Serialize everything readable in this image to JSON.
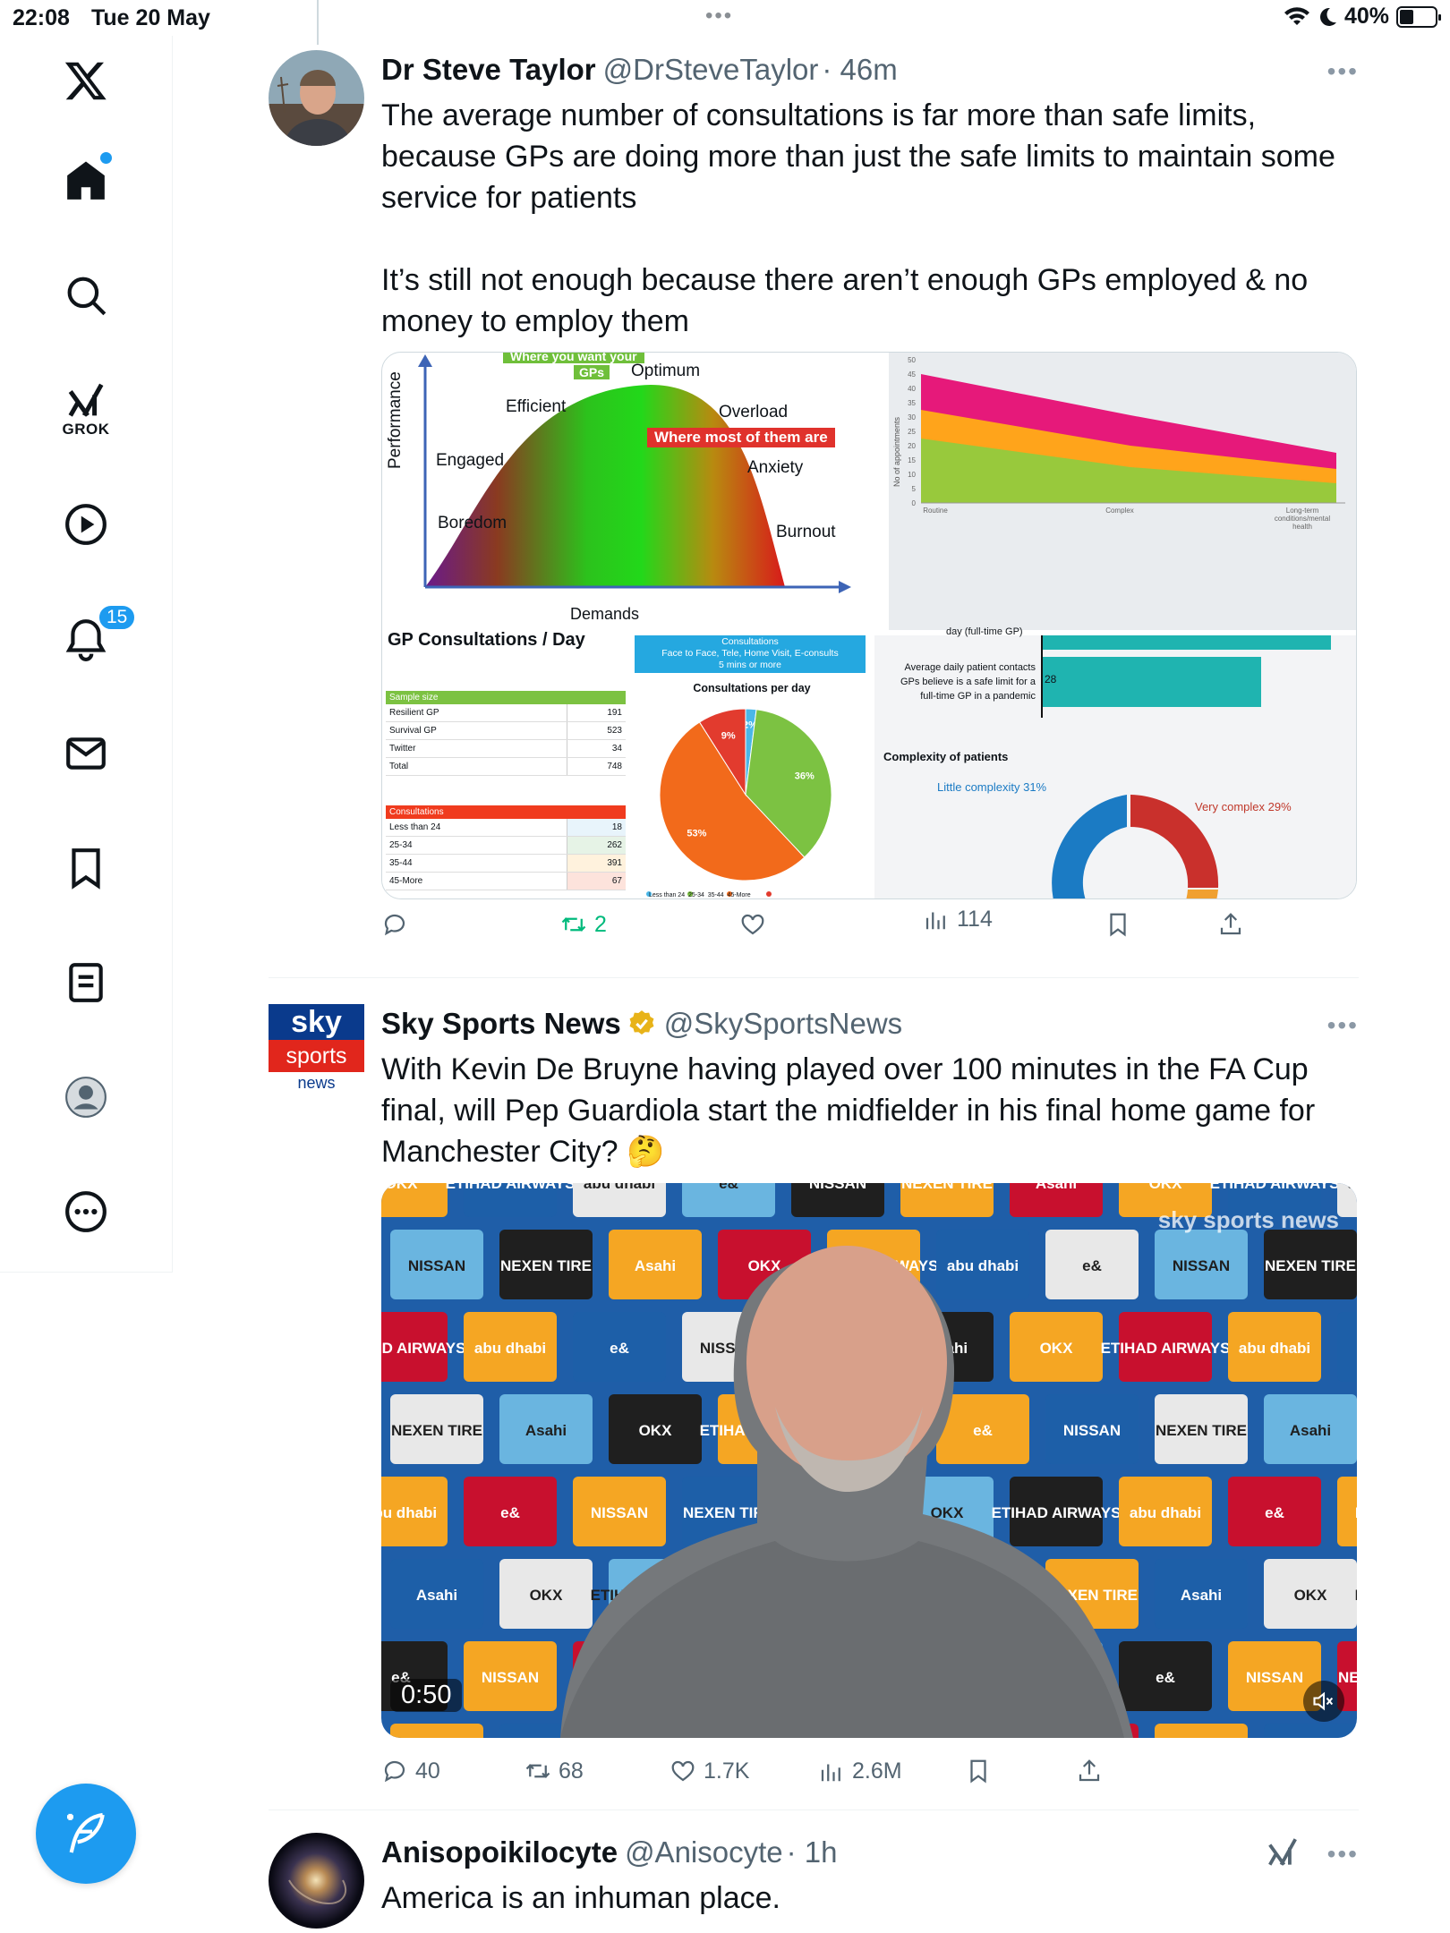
{
  "status_bar": {
    "time": "22:08",
    "date": "Tue 20 May",
    "battery": "40%",
    "battery_level": 0.4
  },
  "sidebar": {
    "grok_label": "GROK",
    "notifications_count": "15"
  },
  "tweets": [
    {
      "name": "Dr Steve Taylor",
      "handle": "@DrSteveTaylor",
      "time": "· 46m",
      "text": "The average number of consultations is far more than safe limits, because GPs are doing more than just the safe limits to maintain some service for patients\n\nIt’s still not enough because there aren’t enough GPs employed & no money to employ them",
      "stats": {
        "replies": "",
        "reposts": "2",
        "likes": "",
        "views": "114"
      },
      "media": {
        "curve": {
          "ylabel": "Performance",
          "xlabel": "Demands",
          "banner_top": "Where you want your",
          "banner_gps": "GPs",
          "optimum": "Optimum",
          "efficient": "Efficient",
          "engaged": "Engaged",
          "boredom": "Boredom",
          "overload": "Overload",
          "where_most": "Where most of them are",
          "anxiety": "Anxiety",
          "burnout": "Burnout"
        },
        "area_chart": {
          "ylabel": "No of appointments",
          "yticks": [
            "50",
            "45",
            "40",
            "35",
            "30",
            "25",
            "20",
            "15",
            "10",
            "5",
            "0"
          ],
          "categories": [
            "Routine",
            "Complex",
            "Long-term conditions/mental health"
          ]
        },
        "table": {
          "title": "GP Consultations / Day",
          "sample_header": "Sample size",
          "sample_rows": [
            {
              "label": "Resilient GP",
              "value": "191"
            },
            {
              "label": "Survival GP",
              "value": "523"
            },
            {
              "label": "Twitter",
              "value": "34"
            },
            {
              "label": "Total",
              "value": "748"
            }
          ],
          "cons_header": "Consultations",
          "cons_rows": [
            {
              "label": "Less than 24",
              "value": "18"
            },
            {
              "label": "25-34",
              "value": "262"
            },
            {
              "label": "35-44",
              "value": "391"
            },
            {
              "label": "45-More",
              "value": "67"
            }
          ]
        },
        "pie": {
          "banner_top": "Consultations",
          "banner": "Face to Face, Tele, Home Visit, E-consults",
          "banner2": "5 mins or more",
          "title": "Consultations per day",
          "slices": [
            {
              "label": "2%",
              "value": 2,
              "color": "#4ab7e8"
            },
            {
              "label": "36%",
              "value": 36,
              "color": "#7cc242"
            },
            {
              "label": "53%",
              "value": 53,
              "color": "#f26a1b"
            },
            {
              "label": "9%",
              "value": 9,
              "color": "#e23b2e"
            }
          ],
          "legend": "Less than 24  25-34  35-44  45-More"
        },
        "bars": {
          "top_label": "day (full-time GP)",
          "label1": "Average daily patient contacts",
          "label2": "GPs believe is a safe limit for a",
          "label3": "full-time GP in a pandemic",
          "value": "28",
          "complexity_title": "Complexity of patients",
          "little": "Little complexity 31%",
          "very": "Very complex 29%"
        }
      }
    },
    {
      "name": "Sky Sports News",
      "handle": "@SkySportsNews",
      "time": "",
      "text": "With Kevin De Bruyne having played over 100 minutes in the FA Cup final, will Pep Guardiola start the midfielder in his final home game for Manchester City? 🤔",
      "logo": {
        "top": "sky",
        "mid": "sports",
        "bottom": "news"
      },
      "stats": {
        "replies": "40",
        "reposts": "68",
        "likes": "1.7K",
        "views": "2.6M"
      },
      "video": {
        "duration": "0:50",
        "watermark": "sky sports news",
        "sponsors": [
          "OKX",
          "NISSAN",
          "ETIHAD AIRWAYS",
          "NEXEN TIRE",
          "abu dhabi",
          "Asahi",
          "e&"
        ]
      }
    },
    {
      "name": "Anisopoikilocyte",
      "handle": "@Anisocyte",
      "time": "· 1h",
      "text": "America is an inhuman place."
    }
  ]
}
